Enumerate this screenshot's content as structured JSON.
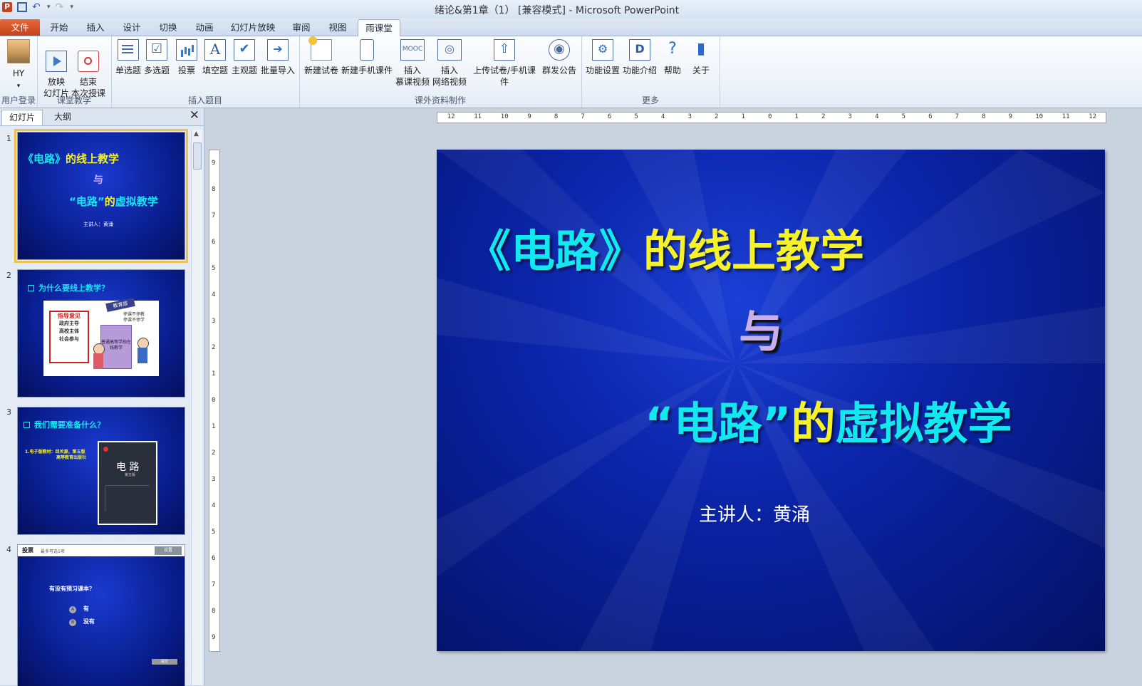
{
  "window": {
    "title": "绪论&第1章（1） [兼容模式] - Microsoft PowerPoint"
  },
  "quick_access": {
    "icons": [
      "powerpoint-logo-icon",
      "save-icon",
      "undo-icon",
      "redo-icon",
      "customize-icon"
    ],
    "logo_letter": "P"
  },
  "tabs": [
    {
      "label": "文件"
    },
    {
      "label": "开始"
    },
    {
      "label": "插入"
    },
    {
      "label": "设计"
    },
    {
      "label": "切换"
    },
    {
      "label": "动画"
    },
    {
      "label": "幻灯片放映"
    },
    {
      "label": "审阅"
    },
    {
      "label": "视图"
    },
    {
      "label": "雨课堂",
      "active": true
    }
  ],
  "ribbon": {
    "groups": [
      {
        "label": "用户登录",
        "buttons": [
          {
            "label": "HY",
            "sub": "▾"
          }
        ]
      },
      {
        "label": "课堂教学",
        "buttons": [
          {
            "label": "放映\n幻灯片"
          },
          {
            "label": "结束\n本次授课"
          }
        ]
      },
      {
        "label": "插入题目",
        "buttons": [
          {
            "label": "单选题"
          },
          {
            "label": "多选题"
          },
          {
            "label": "投票"
          },
          {
            "label": "填空题"
          },
          {
            "label": "主观题"
          },
          {
            "label": "批量导入"
          }
        ]
      },
      {
        "label": "课外资料制作",
        "buttons": [
          {
            "label": "新建试卷"
          },
          {
            "label": "新建手机课件"
          },
          {
            "label": "插入\n慕课视频"
          },
          {
            "label": "插入\n网络视频"
          },
          {
            "label": "上传试卷/手机课件"
          },
          {
            "label": "群发公告"
          }
        ]
      },
      {
        "label": "更多",
        "buttons": [
          {
            "label": "功能设置"
          },
          {
            "label": "功能介绍"
          },
          {
            "label": "帮助"
          },
          {
            "label": "关于"
          }
        ]
      }
    ],
    "icon_text": {
      "mooc": "MOOC",
      "letter_a": "A",
      "fill_d": "D",
      "help_q": "?"
    }
  },
  "pane": {
    "tabs": [
      "幻灯片",
      "大纲"
    ],
    "close": "✕",
    "slide_numbers": [
      "1",
      "2",
      "3",
      "4"
    ]
  },
  "thumbnails": {
    "s1": {
      "t1a": "《电路》",
      "t1b": "的线上教学",
      "yu": "与",
      "t2a": "“电路”",
      "t2b": "的",
      "t2c": "虚拟教学",
      "pres": "主讲人：黄涌"
    },
    "s2": {
      "q": "为什么要线上教学？",
      "img_text": [
        "指导意见",
        "教育部",
        "政府主导",
        "高校主体",
        "社会参与",
        "停课不停教",
        "停课不停学",
        "普通高等学校在线教学"
      ]
    },
    "s3": {
      "q": "我们需要准备什么？",
      "book_line1": "1.电子版教材：邱关源，第五版",
      "book_line2": "高等教育出版社",
      "book_title": "电 路",
      "book_edition": "第五版"
    },
    "s4": {
      "header": "投票",
      "header_sub": "最多可选1项",
      "settings": "设置",
      "question": "有没有预习课本？",
      "options": [
        {
          "key": "A",
          "label": "有"
        },
        {
          "key": "B",
          "label": "没有"
        }
      ],
      "submit": "提交"
    }
  },
  "ruler": {
    "h_ticks": [
      "12",
      "11",
      "10",
      "9",
      "8",
      "7",
      "6",
      "5",
      "4",
      "3",
      "2",
      "1",
      "0",
      "1",
      "2",
      "3",
      "4",
      "5",
      "6",
      "7",
      "8",
      "9",
      "10",
      "11",
      "12"
    ],
    "v_ticks": [
      "9",
      "8",
      "7",
      "6",
      "5",
      "4",
      "3",
      "2",
      "1",
      "0",
      "1",
      "2",
      "3",
      "4",
      "5",
      "6",
      "7",
      "8",
      "9"
    ]
  },
  "slide": {
    "title1_a": "《电路》",
    "title1_b": "的线上教学",
    "connector": "与",
    "title2_a": "“电路”",
    "title2_b": "的",
    "title2_c": "虚拟教学",
    "presenter": "主讲人：黄涌"
  },
  "colors": {
    "slide_bg": "#0b24a8",
    "title_cyan": "#12e8f0",
    "title_yellow": "#f5f22a",
    "connector": "#c9b0ec",
    "file_tab": "#d24b20",
    "selection": "#f0c050"
  }
}
